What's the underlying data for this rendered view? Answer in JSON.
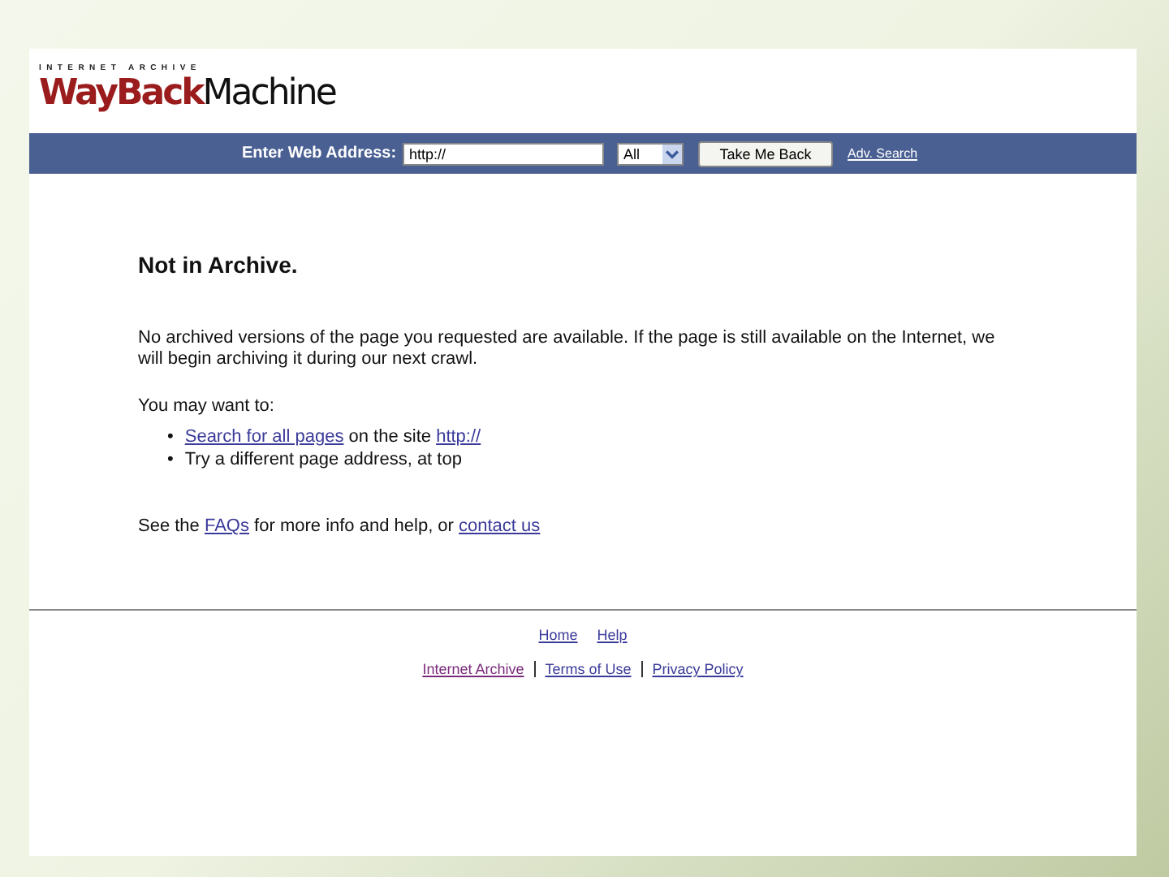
{
  "logo": {
    "tagline": "INTERNET ARCHIVE",
    "word_1": "WayBack",
    "word_2": "Machine"
  },
  "search_bar": {
    "label": "Enter Web Address:",
    "value": "http://",
    "scope": "All",
    "button": "Take Me Back",
    "link": "Adv. Search"
  },
  "heading": "Not in Archive.",
  "message": "No archived versions of the page you requested are available. If the page is still available on the Internet, we will begin archiving it during our next crawl.",
  "suggestions_intro": "You may want to:",
  "suggestions": [
    {
      "bullet": "•",
      "parts": [
        {
          "text": "Search for all pages",
          "link": true
        },
        {
          "text": " on the site ",
          "link": false
        },
        {
          "text": "http://",
          "link": true
        }
      ]
    },
    {
      "bullet": "•",
      "parts": [
        {
          "text": "Try a different page address, at top",
          "link": false
        }
      ]
    }
  ],
  "help_line": {
    "parts": [
      {
        "text": "See the ",
        "link": false
      },
      {
        "text": "FAQs",
        "link": true
      },
      {
        "text": " for more info and help, or ",
        "link": false
      },
      {
        "text": "contact us",
        "link": true
      }
    ]
  },
  "footer": {
    "row_1": [
      "Home",
      "Help"
    ],
    "row_2": [
      "Internet Archive",
      "Terms of Use",
      "Privacy Policy"
    ]
  }
}
